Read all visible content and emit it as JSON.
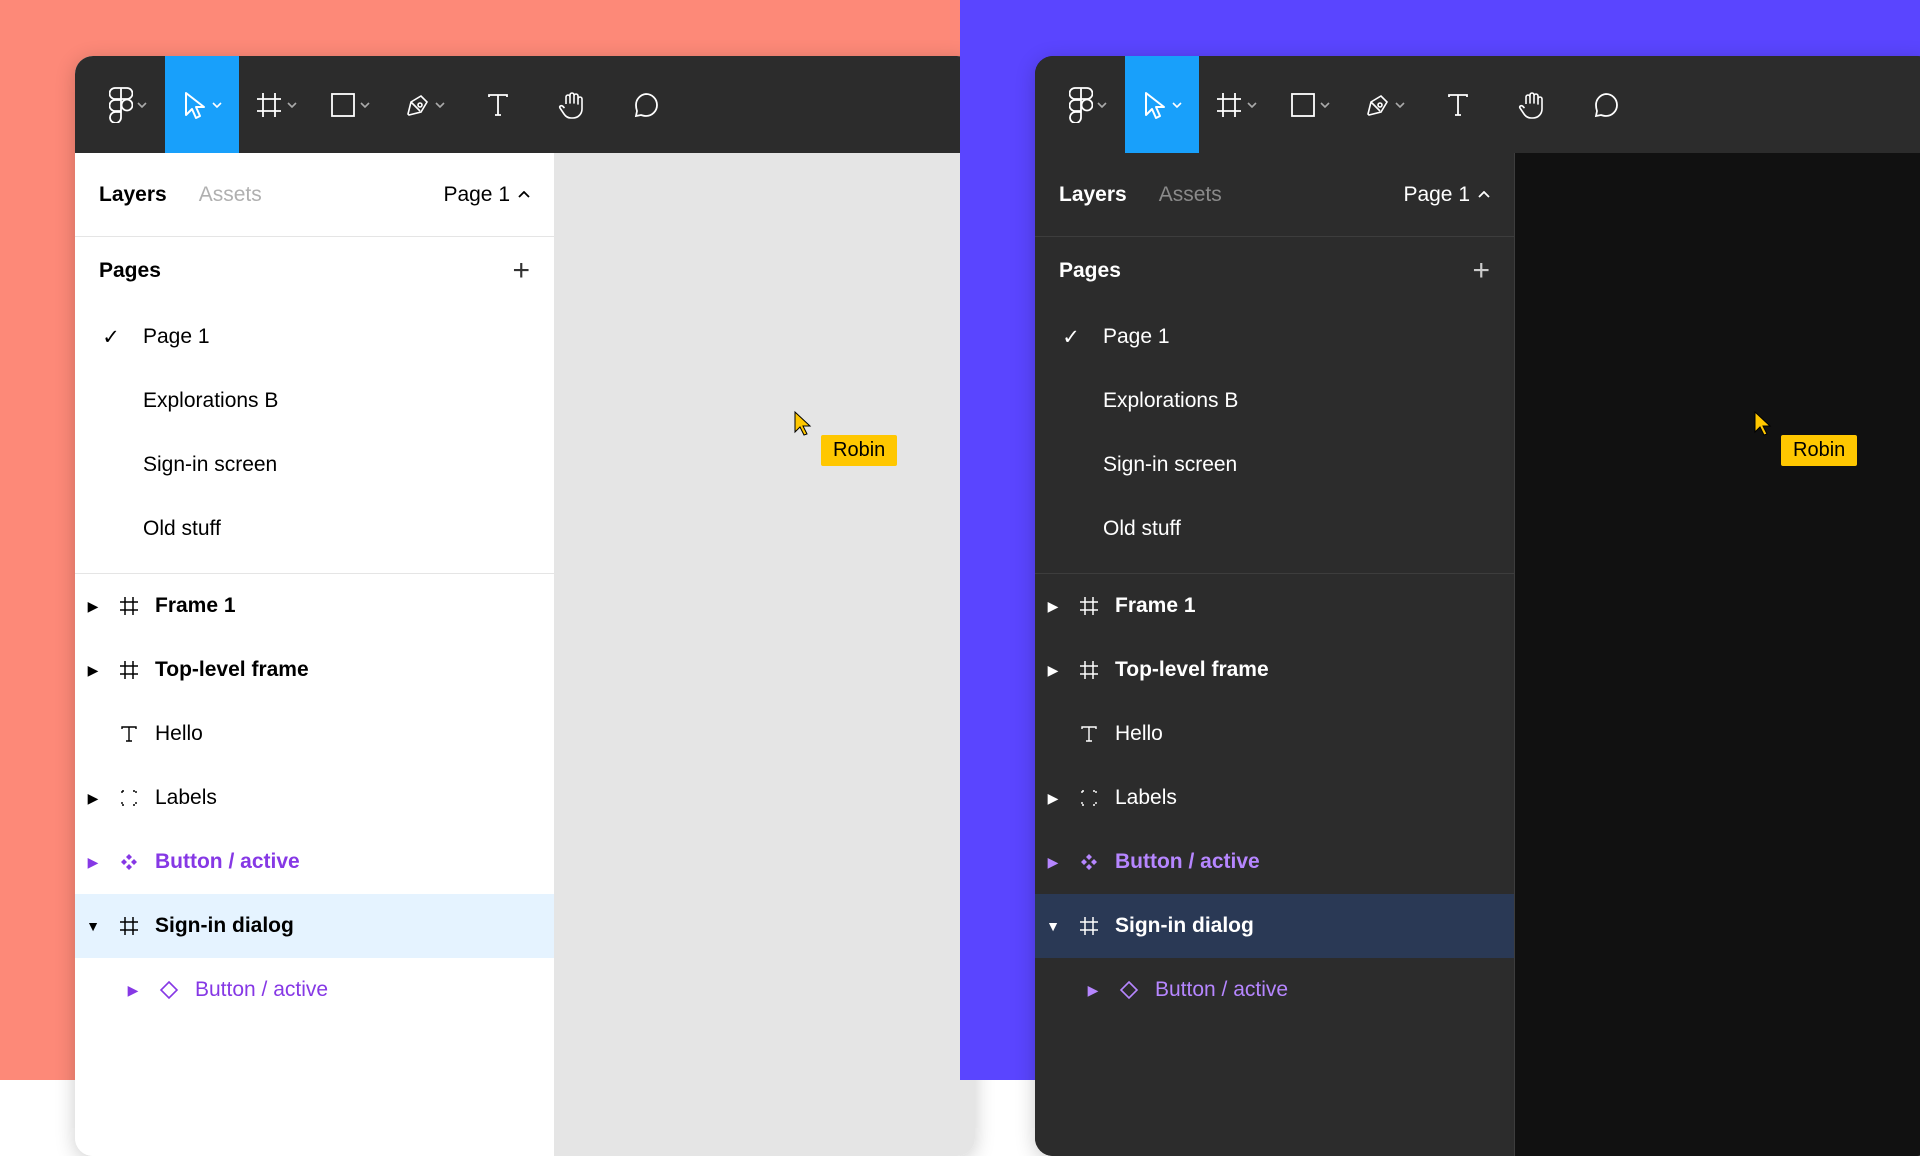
{
  "tabs": {
    "layers": "Layers",
    "assets": "Assets"
  },
  "page_selector": "Page 1",
  "pages_section": {
    "title": "Pages"
  },
  "pages": [
    {
      "name": "Page 1",
      "current": true
    },
    {
      "name": "Explorations B",
      "current": false
    },
    {
      "name": "Sign-in screen",
      "current": false
    },
    {
      "name": "Old stuff",
      "current": false
    }
  ],
  "layers": [
    {
      "name": "Frame 1",
      "icon": "frame",
      "expandable": true,
      "bold": true
    },
    {
      "name": "Top-level frame",
      "icon": "frame",
      "expandable": true,
      "bold": true
    },
    {
      "name": "Hello",
      "icon": "text",
      "expandable": false,
      "bold": false
    },
    {
      "name": "Labels",
      "icon": "group",
      "expandable": true,
      "bold": false
    },
    {
      "name": "Button / active",
      "icon": "component",
      "expandable": true,
      "bold": true,
      "purple": true
    },
    {
      "name": "Sign-in dialog",
      "icon": "frame",
      "expandable": true,
      "bold": true,
      "selected": true,
      "expanded": true
    },
    {
      "name": "Button / active",
      "icon": "instance",
      "expandable": true,
      "bold": false,
      "purple": true,
      "indent": true
    }
  ],
  "cursor": {
    "user": "Robin",
    "color": "#FFC700"
  }
}
